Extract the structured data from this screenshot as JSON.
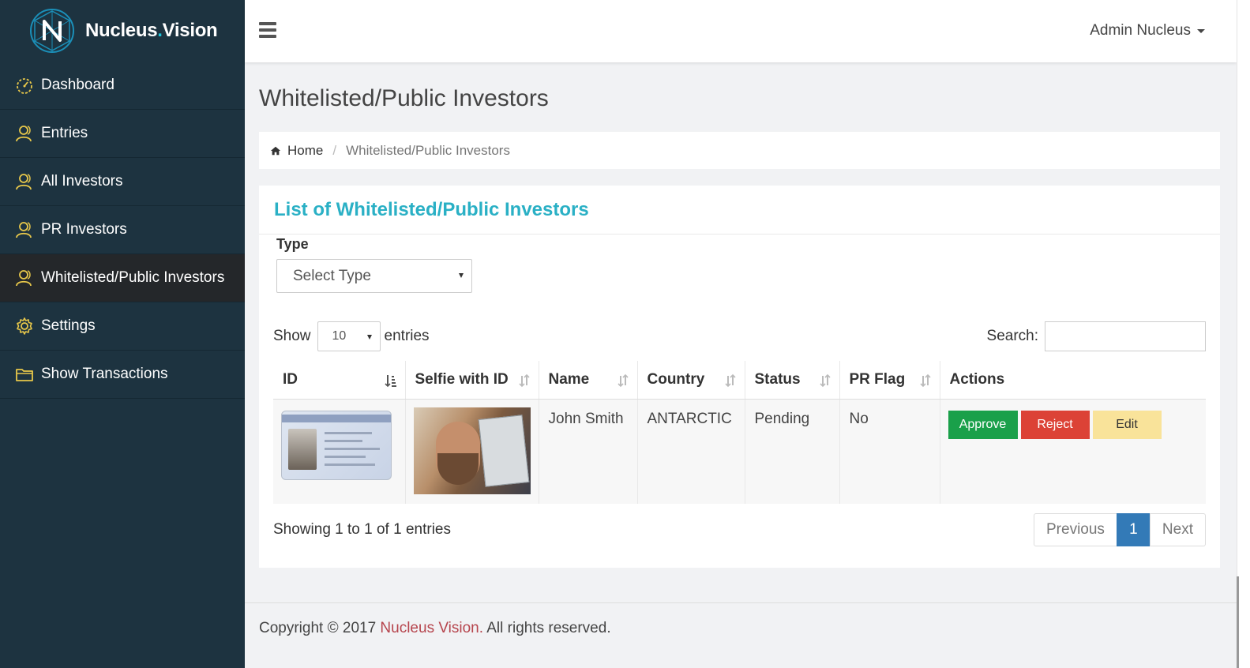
{
  "brand": {
    "name_main": "Nucleus",
    "name_dot": ".",
    "name_end": "Vision"
  },
  "sidebar": {
    "items": [
      {
        "label": "Dashboard",
        "icon": "dashboard-icon",
        "active": false
      },
      {
        "label": "Entries",
        "icon": "users-icon",
        "active": false
      },
      {
        "label": "All Investors",
        "icon": "users-icon",
        "active": false
      },
      {
        "label": "PR Investors",
        "icon": "users-icon",
        "active": false
      },
      {
        "label": "Whitelisted/Public Investors",
        "icon": "users-icon",
        "active": true
      },
      {
        "label": "Settings",
        "icon": "gear-icon",
        "active": false
      },
      {
        "label": "Show Transactions",
        "icon": "folder-icon",
        "active": false
      }
    ]
  },
  "header": {
    "user": "Admin Nucleus"
  },
  "page": {
    "title": "Whitelisted/Public Investors"
  },
  "breadcrumb": {
    "home": "Home",
    "separator": "/",
    "current": "Whitelisted/Public Investors"
  },
  "panel": {
    "title": "List of Whitelisted/Public Investors",
    "type_label": "Type",
    "type_select": "Select Type"
  },
  "table_controls": {
    "show_label": "Show",
    "page_length": "10",
    "entries_label": "entries",
    "search_label": "Search:",
    "search_value": ""
  },
  "table": {
    "columns": [
      "ID",
      "Selfie with ID",
      "Name",
      "Country",
      "Status",
      "PR Flag",
      "Actions"
    ],
    "rows": [
      {
        "name": "John Smith",
        "country": "ANTARCTIC",
        "status": "Pending",
        "pr_flag": "No",
        "actions": [
          "Approve",
          "Reject",
          "Edit"
        ]
      }
    ]
  },
  "pagination": {
    "info": "Showing 1 to 1 of 1 entries",
    "previous": "Previous",
    "current_page": "1",
    "next": "Next"
  },
  "footer": {
    "prefix": "Copyright © 2017 ",
    "brand": "Nucleus Vision.",
    "suffix": " All rights reserved."
  },
  "colors": {
    "sidebar_bg": "#1d3340",
    "active_item_bg": "#24272a",
    "accent_cyan": "#2ab0c5",
    "icon_yellow": "#e8c84a",
    "approve": "#1aa04a",
    "reject": "#dc4236",
    "edit": "#f9e39a",
    "page_active": "#337ab7",
    "footer_brand": "#b6454d"
  }
}
